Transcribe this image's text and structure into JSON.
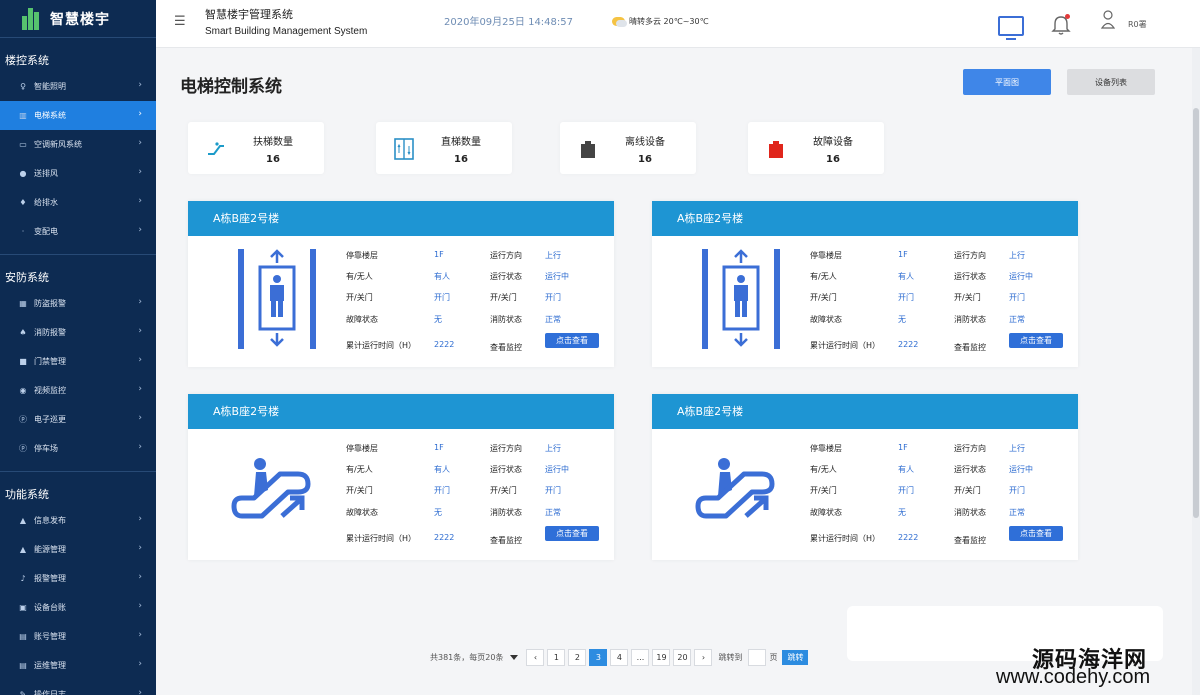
{
  "brand": {
    "title": "智慧楼宇"
  },
  "sidebar": {
    "groups": [
      {
        "title": "楼控系统",
        "items": [
          {
            "label": "智能照明",
            "icon": "bulb-icon",
            "glyph": "♀"
          },
          {
            "label": "电梯系统",
            "icon": "elevator-icon",
            "glyph": "▥",
            "active": true
          },
          {
            "label": "空调新风系统",
            "icon": "ac-icon",
            "glyph": "▭"
          },
          {
            "label": "送排风",
            "icon": "location-icon",
            "glyph": "●"
          },
          {
            "label": "给排水",
            "icon": "drop-icon",
            "glyph": "♦"
          },
          {
            "label": "变配电",
            "icon": "power-icon",
            "glyph": "·"
          }
        ]
      },
      {
        "title": "安防系统",
        "items": [
          {
            "label": "防盗报警",
            "icon": "grid-icon",
            "glyph": "▦"
          },
          {
            "label": "消防报警",
            "icon": "fire-icon",
            "glyph": "♠"
          },
          {
            "label": "门禁管理",
            "icon": "door-icon",
            "glyph": "■"
          },
          {
            "label": "视频监控",
            "icon": "camera-icon",
            "glyph": "◉"
          },
          {
            "label": "电子巡更",
            "icon": "patrol-icon",
            "glyph": "ⓟ"
          },
          {
            "label": "停车场",
            "icon": "parking-icon",
            "glyph": "ⓟ"
          }
        ]
      },
      {
        "title": "功能系统",
        "items": [
          {
            "label": "信息发布",
            "icon": "info-icon",
            "glyph": "▲"
          },
          {
            "label": "能源管理",
            "icon": "energy-icon",
            "glyph": "▲"
          },
          {
            "label": "报警管理",
            "icon": "alarm-icon",
            "glyph": "♪"
          },
          {
            "label": "设备台账",
            "icon": "ledger-icon",
            "glyph": "▣"
          },
          {
            "label": "账号管理",
            "icon": "account-icon",
            "glyph": "▤"
          },
          {
            "label": "运维管理",
            "icon": "ops-icon",
            "glyph": "▤"
          },
          {
            "label": "操作日志",
            "icon": "log-icon",
            "glyph": "✎"
          }
        ]
      }
    ]
  },
  "header": {
    "title": "智慧楼宇管理系统",
    "subtitle": "Smart Building Management System",
    "datetime": "2020年09月25日 14:48:57",
    "weather": "晴转多云  20℃~30℃",
    "user": "R0署"
  },
  "page": {
    "title": "电梯控制系统",
    "btn_plan": "平面图",
    "btn_list": "设备列表"
  },
  "stats": [
    {
      "label": "扶梯数量",
      "value": "16",
      "color": "#1c9bc9"
    },
    {
      "label": "直梯数量",
      "value": "16",
      "color": "#2b8fc6"
    },
    {
      "label": "离线设备",
      "value": "16",
      "color": "#444444"
    },
    {
      "label": "故障设备",
      "value": "16",
      "color": "#e0261c"
    }
  ],
  "panels": [
    {
      "title": "A栋B座2号楼",
      "type": "elevator",
      "labels": [
        "停靠楼层",
        "有/无人",
        "开/关门",
        "故障状态",
        "累计运行时间（H）"
      ],
      "values": [
        "1F",
        "有人",
        "开门",
        "无",
        "2222"
      ],
      "labels2": [
        "运行方向",
        "运行状态",
        "开/关门",
        "消防状态",
        "查看监控"
      ],
      "values2": [
        "上行",
        "运行中",
        "开门",
        "正常"
      ],
      "btn": "点击查看"
    },
    {
      "title": "A栋B座2号楼",
      "type": "elevator",
      "labels": [
        "停靠楼层",
        "有/无人",
        "开/关门",
        "故障状态",
        "累计运行时间（H）"
      ],
      "values": [
        "1F",
        "有人",
        "开门",
        "无",
        "2222"
      ],
      "labels2": [
        "运行方向",
        "运行状态",
        "开/关门",
        "消防状态",
        "查看监控"
      ],
      "values2": [
        "上行",
        "运行中",
        "开门",
        "正常"
      ],
      "btn": "点击查看"
    },
    {
      "title": "A栋B座2号楼",
      "type": "escalator",
      "labels": [
        "停靠楼层",
        "有/无人",
        "开/关门",
        "故障状态",
        "累计运行时间（H）"
      ],
      "values": [
        "1F",
        "有人",
        "开门",
        "无",
        "2222"
      ],
      "labels2": [
        "运行方向",
        "运行状态",
        "开/关门",
        "消防状态",
        "查看监控"
      ],
      "values2": [
        "上行",
        "运行中",
        "开门",
        "正常"
      ],
      "btn": "点击查看"
    },
    {
      "title": "A栋B座2号楼",
      "type": "escalator",
      "labels": [
        "停靠楼层",
        "有/无人",
        "开/关门",
        "故障状态",
        "累计运行时间（H）"
      ],
      "values": [
        "1F",
        "有人",
        "开门",
        "无",
        "2222"
      ],
      "labels2": [
        "运行方向",
        "运行状态",
        "开/关门",
        "消防状态",
        "查看监控"
      ],
      "values2": [
        "上行",
        "运行中",
        "开门",
        "正常"
      ],
      "btn": "点击查看"
    }
  ],
  "pagination": {
    "total": "共381条，每页20条",
    "prev": "‹",
    "pages": [
      "1",
      "2",
      "3",
      "4",
      "...",
      "19",
      "20"
    ],
    "active_page": "3",
    "next": "›",
    "jump_label": "跳转到",
    "jump_unit": "页",
    "go": "跳转"
  },
  "watermark": {
    "line1": "源码海洋网",
    "line2": "www.codehy.com"
  },
  "colors": {
    "sidebar": "#0d2b52",
    "active": "#1f7fe0",
    "panel_head": "#1e95d3",
    "primary": "#3f86e8",
    "elevator_icon": "#2f6fd8"
  }
}
